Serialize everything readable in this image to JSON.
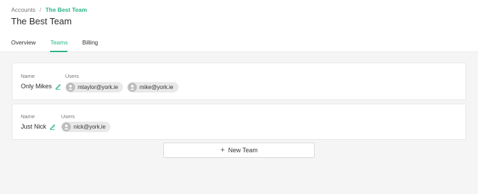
{
  "breadcrumb": {
    "parent": "Accounts",
    "separator": "/",
    "current": "The Best Team"
  },
  "page_title": "The Best Team",
  "tabs": [
    {
      "label": "Overview",
      "active": false
    },
    {
      "label": "Teams",
      "active": true
    },
    {
      "label": "Billing",
      "active": false
    }
  ],
  "teams": [
    {
      "name_label": "Name",
      "users_label": "Users",
      "name": "Only Mikes",
      "users": [
        "mtaylor@york.ie",
        "mike@york.ie"
      ]
    },
    {
      "name_label": "Name",
      "users_label": "Users",
      "name": "Just Nick",
      "users": [
        "nick@york.ie"
      ]
    }
  ],
  "new_team_button": {
    "icon": "+",
    "label": "New Team"
  },
  "colors": {
    "accent": "#2bb38a",
    "background": "#f5f5f5",
    "chip": "#e9e9e9"
  }
}
